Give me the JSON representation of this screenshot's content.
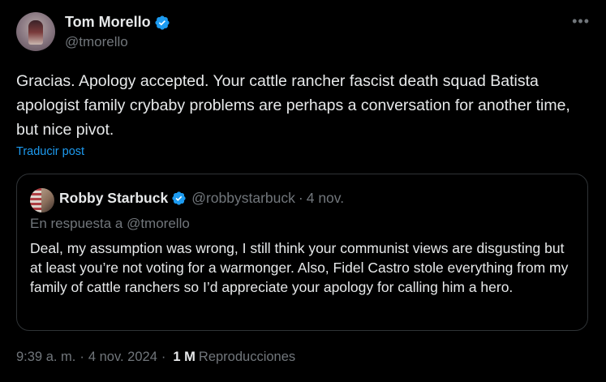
{
  "author": {
    "name": "Tom Morello",
    "handle": "@tmorello"
  },
  "more_icon": "•••",
  "tweet_text": "Gracias. Apology accepted. Your cattle rancher fascist death squad Batista apologist family crybaby problems are perhaps a conversation for another time, but nice pivot.",
  "translate_label": "Traducir post",
  "quote": {
    "name": "Robby Starbuck",
    "handle": "@robbystarbuck",
    "separator": "·",
    "date": "4 nov.",
    "reply_to": "En respuesta a @tmorello",
    "text": "Deal, my assumption was wrong, I still think your communist views are disgusting but at least you’re not voting for a warmonger. Also, Fidel Castro stole everything from my family of cattle ranchers so I’d appreciate your apology for calling him a hero."
  },
  "meta": {
    "time": "9:39 a. m.",
    "separator": "·",
    "date": "4 nov. 2024",
    "views_count": "1 M",
    "views_label": "Reproducciones"
  },
  "colors": {
    "background": "#000000",
    "text": "#e7e9ea",
    "muted": "#71767b",
    "accent": "#1d9bf0",
    "border": "#2f3336"
  }
}
